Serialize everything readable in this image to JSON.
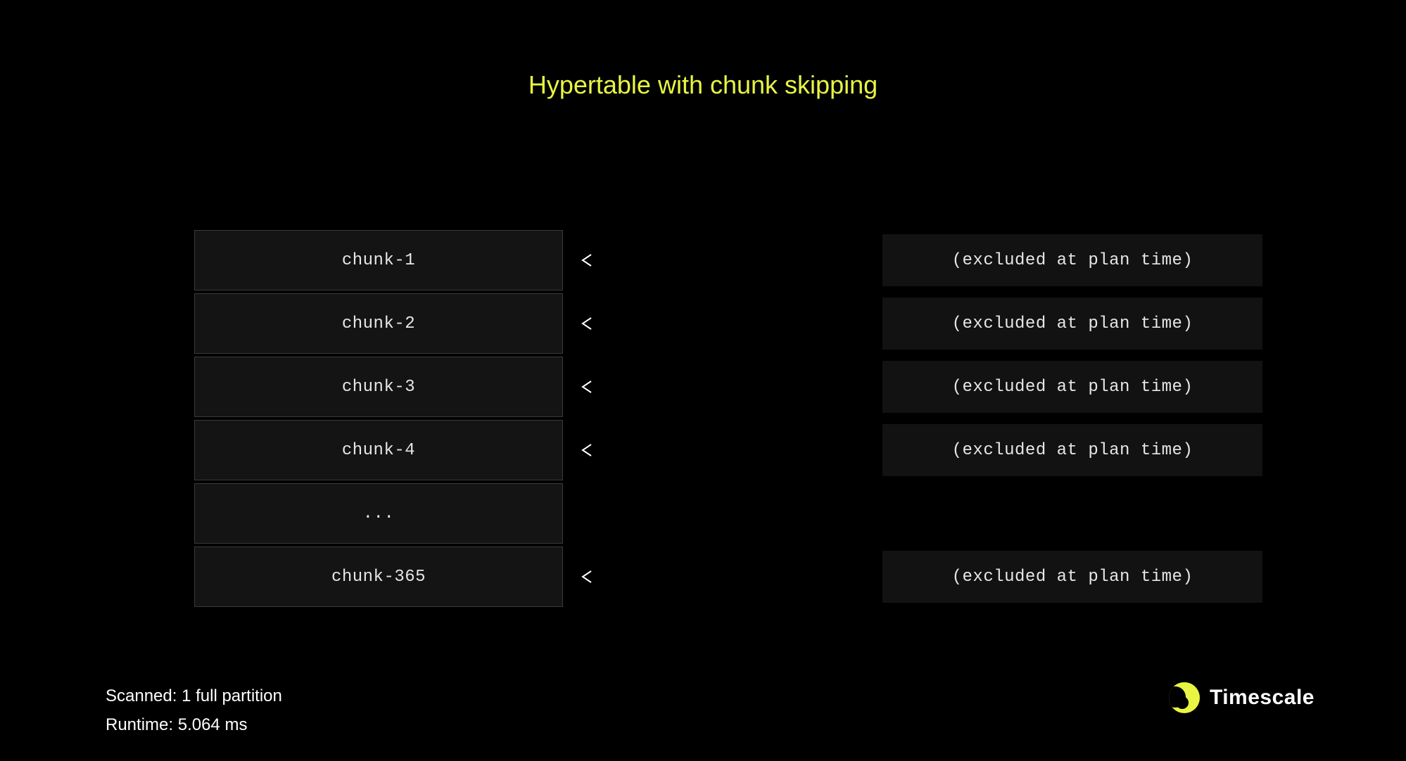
{
  "title": "Hypertable with chunk skipping",
  "rows": [
    {
      "chunk": "chunk-1",
      "status": "(excluded at plan time)",
      "arrow": true
    },
    {
      "chunk": "chunk-2",
      "status": "(excluded at plan time)",
      "arrow": true
    },
    {
      "chunk": "chunk-3",
      "status": "(excluded at plan time)",
      "arrow": true
    },
    {
      "chunk": "chunk-4",
      "status": "(excluded at plan time)",
      "arrow": true
    },
    {
      "chunk": "...",
      "status": "",
      "arrow": false
    },
    {
      "chunk": "chunk-365",
      "status": "(excluded at plan time)",
      "arrow": true
    }
  ],
  "stats": {
    "scanned_label": "Scanned:",
    "scanned_value": "1 full partition",
    "runtime_label": "Runtime:",
    "runtime_value": "5.064 ms"
  },
  "brand": "Timescale"
}
